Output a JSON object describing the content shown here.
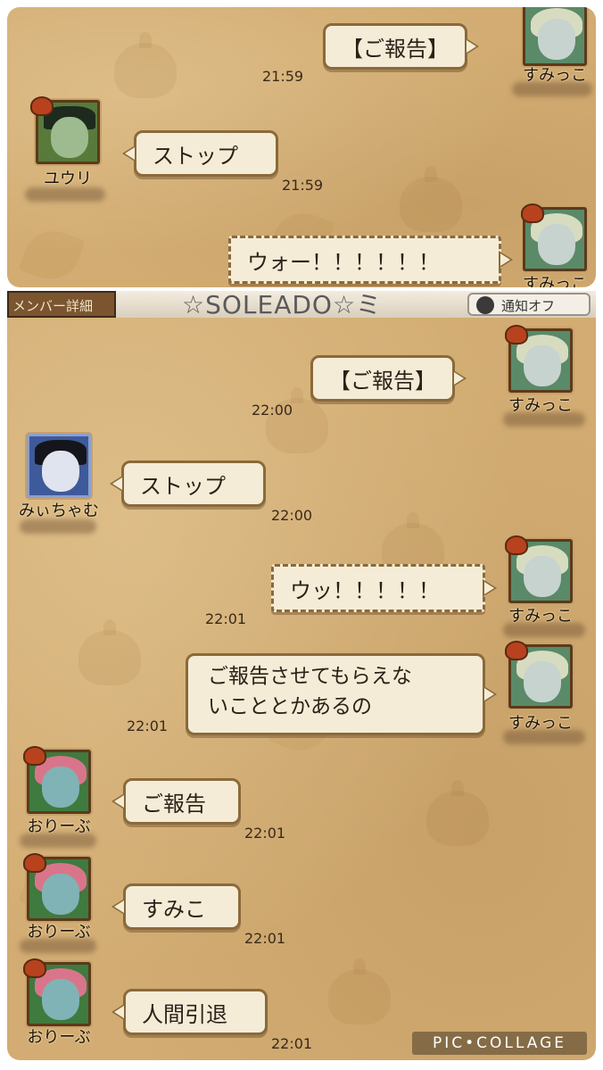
{
  "top_panel": {
    "messages": [
      {
        "side": "right",
        "text": "【ご報告】",
        "time": "21:59",
        "sender": "すみっこ"
      },
      {
        "side": "left",
        "text": "ストップ",
        "time": "21:59",
        "sender": "ユウリ"
      },
      {
        "side": "right",
        "text": "ウォー！！！！！！",
        "time": "",
        "sender": "すみっこ"
      }
    ]
  },
  "header": {
    "member_details": "メンバー詳細",
    "room_title": "☆SOLEADO☆ミ",
    "notify": "通知オフ"
  },
  "bottom_panel": {
    "messages": [
      {
        "side": "right",
        "text": "【ご報告】",
        "time": "22:00",
        "sender": "すみっこ"
      },
      {
        "side": "left",
        "text": "ストップ",
        "time": "22:00",
        "sender": "みぃちゃむ"
      },
      {
        "side": "right",
        "text": "ウッ！！！！！",
        "time": "22:01",
        "sender": "すみっこ"
      },
      {
        "side": "right",
        "text_line1": "ご報告させてもらえな",
        "text_line2": "いこととかあるの",
        "time": "22:01",
        "sender": "すみっこ"
      },
      {
        "side": "left",
        "text": "ご報告",
        "time": "22:01",
        "sender": "おりーぶ"
      },
      {
        "side": "left",
        "text": "すみこ",
        "time": "22:01",
        "sender": "おりーぶ"
      },
      {
        "side": "left",
        "text": "人間引退",
        "time": "22:01",
        "sender": "おりーぶ"
      }
    ]
  },
  "watermark": "PIC•COLLAGE"
}
